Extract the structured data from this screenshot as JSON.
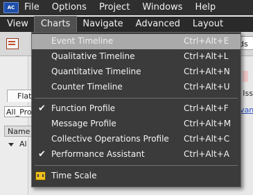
{
  "menubar": {
    "app_logo_text": "AC",
    "row1": [
      "File",
      "Options",
      "Project",
      "Windows",
      "Help"
    ],
    "row2": [
      "View",
      "Charts",
      "Navigate",
      "Advanced",
      "Layout"
    ]
  },
  "background": {
    "toolbar_text_right": "ds",
    "flat_tab": "Flat",
    "combo_value": "All_Proc",
    "name_header": "Name",
    "tree_item": "Al",
    "right_tab": "e Iss",
    "right_link": "lvan"
  },
  "charts_menu": {
    "items": [
      {
        "label": "Event Timeline",
        "shortcut": "Ctrl+Alt+E",
        "checked": false,
        "highlighted": true
      },
      {
        "label": "Qualitative Timeline",
        "shortcut": "Ctrl+Alt+L",
        "checked": false
      },
      {
        "label": "Quantitative Timeline",
        "shortcut": "Ctrl+Alt+N",
        "checked": false
      },
      {
        "label": "Counter Timeline",
        "shortcut": "Ctrl+Alt+U",
        "checked": false
      },
      {
        "label": "Function Profile",
        "shortcut": "Ctrl+Alt+F",
        "checked": true
      },
      {
        "label": "Message Profile",
        "shortcut": "Ctrl+Alt+M",
        "checked": false
      },
      {
        "label": "Collective Operations Profile",
        "shortcut": "Ctrl+Alt+C",
        "checked": false
      },
      {
        "label": "Performance Assistant",
        "shortcut": "Ctrl+Alt+A",
        "checked": true
      },
      {
        "label": "Time Scale",
        "shortcut": "",
        "checked": false,
        "icon": "time-scale-icon"
      }
    ]
  },
  "colors": {
    "menubar_bg": "#2f2f2f",
    "menu_bg": "#3b3b3b",
    "highlight_bg": "#aaaaaa",
    "link": "#2952c7"
  }
}
